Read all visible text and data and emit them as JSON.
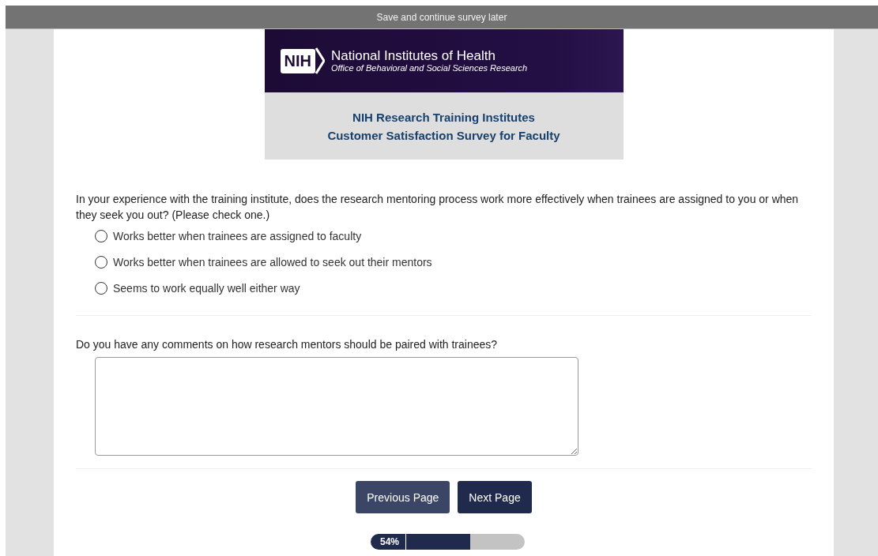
{
  "save_bar": {
    "label": "Save and continue survey later"
  },
  "banner": {
    "logo": "NIH",
    "org_name": "National Institutes of Health",
    "org_office": "Office of Behavioral and Social Sciences Research",
    "title_lines": [
      "NIH Research Training Institutes",
      "Customer Satisfaction Survey for Faculty"
    ]
  },
  "questions": [
    {
      "kind": "radio",
      "text": "In your experience with the training institute, does the research mentoring process work more effectively when trainees are assigned to you or when they seek you out? (Please check one.)",
      "options": [
        {
          "label": "Works better when trainees are assigned to faculty",
          "selected": false
        },
        {
          "label": "Works better when trainees are allowed to seek out their mentors",
          "selected": false
        },
        {
          "label": "Seems to work equally well either way",
          "selected": false
        }
      ]
    },
    {
      "kind": "textarea",
      "text": "Do you have any comments on how research mentors should be paired with trainees?"
    }
  ],
  "buttons": [
    {
      "label": "Previous Page",
      "kind": "secondary"
    },
    {
      "label": "Next Page",
      "kind": "primary"
    }
  ],
  "progress": {
    "label": "54%",
    "level": 0.54
  }
}
